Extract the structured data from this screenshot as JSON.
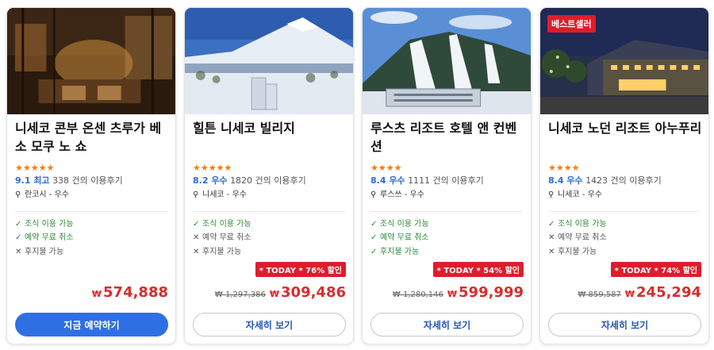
{
  "hotels": [
    {
      "name": "니세코 콘부 온센 츠루가 베소 모쿠 노 쇼",
      "stars": "★★★★★",
      "score": "9.1 최고",
      "reviews": "338 건의 이용후기",
      "location": "란코시 - 우수",
      "amenities": [
        "조식 이용 가능",
        "예약 무료 취소",
        "후지불 가능"
      ],
      "price": "574,888",
      "button": "지금 예약하기"
    },
    {
      "name": "힐튼 니세코 빌리지",
      "stars": "★★★★★",
      "score": "8.2 우수",
      "reviews": "1820 건의 이용후기",
      "location": "니세코 - 우수",
      "amenities": [
        "조식 이용 가능",
        "예약 무료 취소",
        "후지불 가능"
      ],
      "deal": "* TODAY * 76% 할인",
      "original_price": "₩ 1,297,386",
      "price": "309,486",
      "button": "자세히 보기"
    },
    {
      "name": "루스츠 리조트 호텔 앤 컨벤션",
      "stars": "★★★★",
      "score": "8.4 우수",
      "reviews": "1111 건의 이용후기",
      "location": "루스쓰 - 우수",
      "amenities": [
        "조식 이용 가능",
        "예약 무료 취소",
        "후지불 가능"
      ],
      "deal": "* TODAY * 54% 할인",
      "original_price": "₩ 1,280,146",
      "price": "599,999",
      "button": "자세히 보기"
    },
    {
      "badge": "베스트셀러",
      "name": "니세코 노던 리조트 아누푸리",
      "stars": "★★★★",
      "score": "8.4 우수",
      "reviews": "1423 건의 이용후기",
      "location": "니세코 - 우수",
      "amenities": [
        "조식 이용 가능",
        "예약 무료 취소",
        "후지불 가능"
      ],
      "deal": "* TODAY * 74% 할인",
      "original_price": "₩ 859,587",
      "price": "245,294",
      "button": "자세히 보기"
    }
  ],
  "currency_symbol": "₩",
  "colors": {
    "accent": "#2f6fe4",
    "price": "#d82d2d",
    "deal": "#e01c2b",
    "available": "#2d8a39",
    "stars": "#ff7a00"
  }
}
